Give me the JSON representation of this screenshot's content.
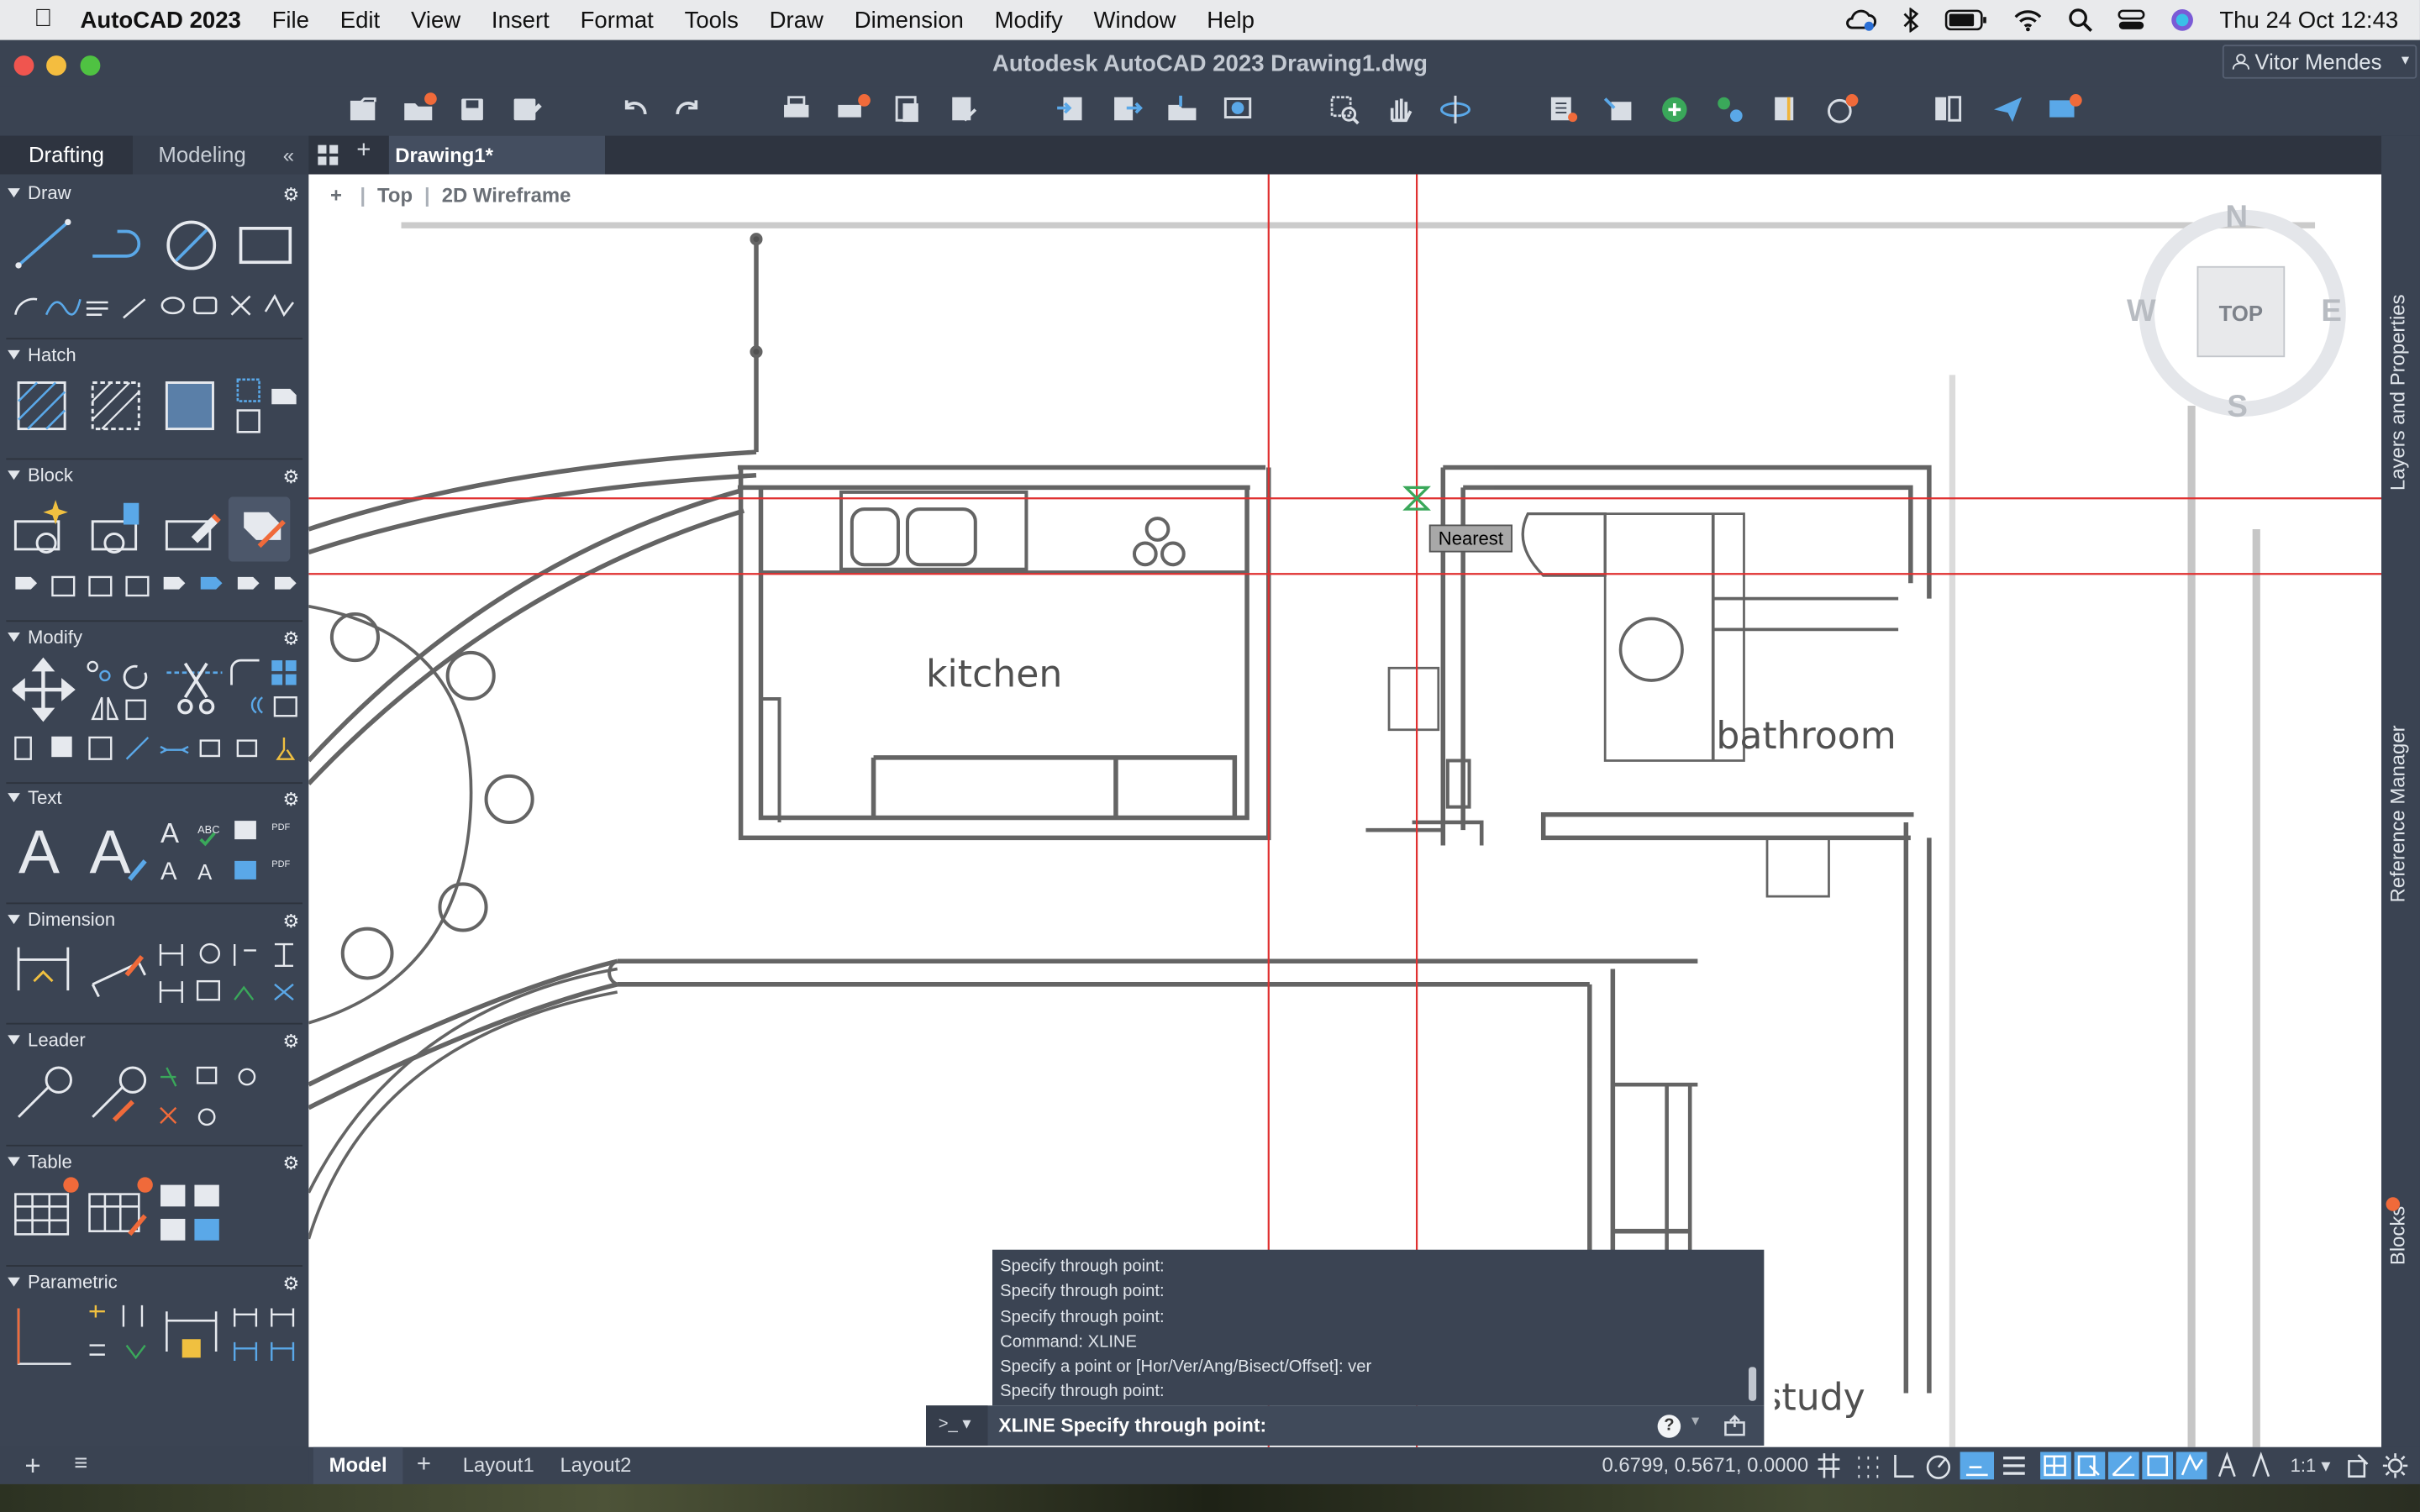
{
  "menubar": {
    "app_name": "AutoCAD 2023",
    "items": [
      "File",
      "Edit",
      "View",
      "Insert",
      "Format",
      "Tools",
      "Draw",
      "Dimension",
      "Modify",
      "Window",
      "Help"
    ],
    "datetime": "Thu 24 Oct  12:43"
  },
  "window": {
    "title": "Autodesk AutoCAD 2023    Drawing1.dwg",
    "user": "Vitor Mendes"
  },
  "palette": {
    "tabs": [
      "Drafting",
      "Modeling"
    ],
    "sections": [
      "Draw",
      "Hatch",
      "Block",
      "Modify",
      "Text",
      "Dimension",
      "Leader",
      "Table",
      "Parametric"
    ]
  },
  "document": {
    "tab": "Drawing1*",
    "view_label": "Top",
    "visual_style": "2D Wireframe"
  },
  "drawing": {
    "room_kitchen": "kitchen",
    "room_bathroom": "bathroom",
    "room_study": "study",
    "snap_tooltip": "Nearest"
  },
  "viewcube": {
    "top": "TOP",
    "n": "N",
    "s": "S",
    "e": "E",
    "w": "W"
  },
  "right_panels": [
    "Layers and Properties",
    "Reference Manager",
    "Blocks"
  ],
  "command": {
    "history": [
      "Specify through point:",
      "Specify through point:",
      "Specify through point:",
      "Command: XLINE",
      "Specify a point or [Hor/Ver/Ang/Bisect/Offset]: ver",
      "Specify through point:"
    ],
    "prompt": "XLINE Specify through point:",
    "prompt_icon": ">_"
  },
  "layout_tabs": [
    "Model",
    "Layout1",
    "Layout2"
  ],
  "status": {
    "coordinates": "0.6799, 0.5671, 0.0000",
    "scale": "1:1"
  },
  "colors": {
    "accent_orange": "#f06a3a",
    "crosshair_red": "#e03030",
    "icon_blue": "#5aa8e8"
  }
}
